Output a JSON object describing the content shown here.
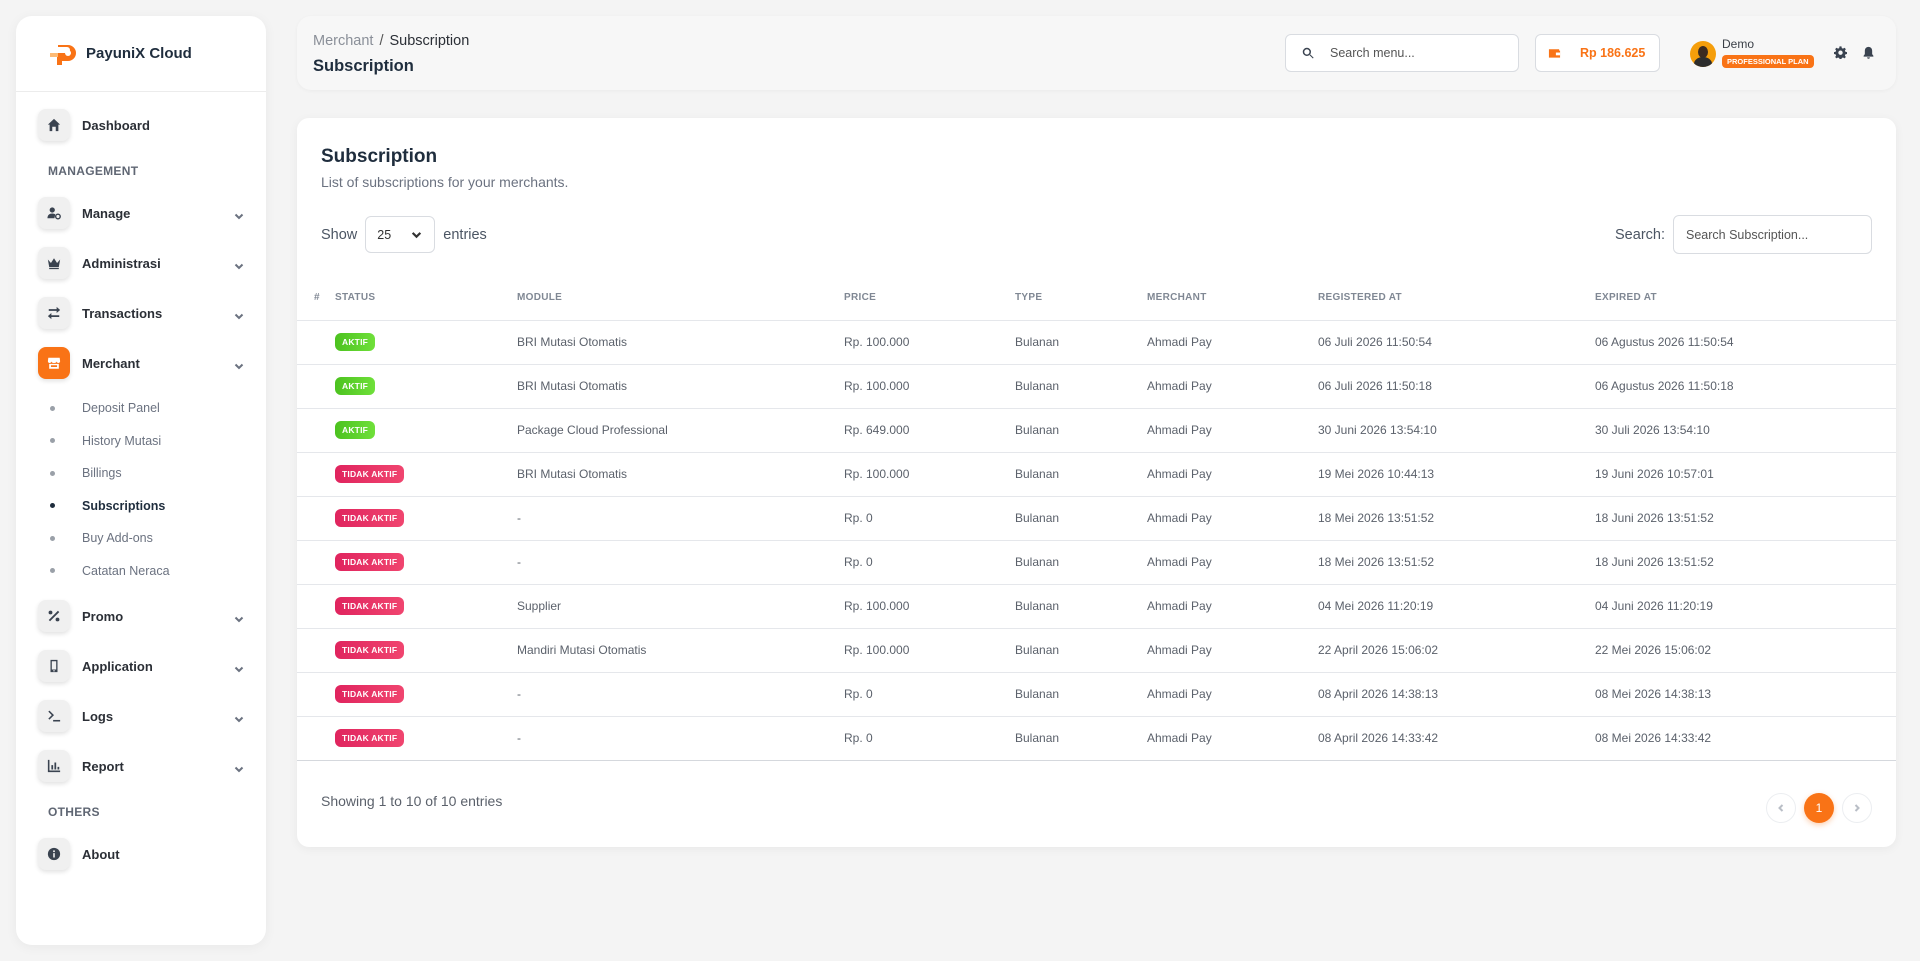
{
  "brand": {
    "name": "PayuniX Cloud"
  },
  "sidebar": {
    "dashboard": "Dashboard",
    "section_management": "MANAGEMENT",
    "items": [
      {
        "label": "Manage",
        "icon": "user-cog-icon"
      },
      {
        "label": "Administrasi",
        "icon": "crown-icon"
      },
      {
        "label": "Transactions",
        "icon": "arrows-exchange-icon"
      },
      {
        "label": "Merchant",
        "icon": "store-icon"
      }
    ],
    "merchant_sub": [
      {
        "label": "Deposit Panel"
      },
      {
        "label": "History Mutasi"
      },
      {
        "label": "Billings"
      },
      {
        "label": "Subscriptions",
        "active": true
      },
      {
        "label": "Buy Add-ons"
      },
      {
        "label": "Catatan Neraca"
      }
    ],
    "items2": [
      {
        "label": "Promo",
        "icon": "percent-icon"
      },
      {
        "label": "Application",
        "icon": "mobile-icon"
      },
      {
        "label": "Logs",
        "icon": "terminal-icon"
      },
      {
        "label": "Report",
        "icon": "chart-icon"
      }
    ],
    "section_others": "OTHERS",
    "about": "About"
  },
  "header": {
    "breadcrumb_parent": "Merchant",
    "breadcrumb_sep": "/",
    "breadcrumb_current": "Subscription",
    "title": "Subscription",
    "search_placeholder": "Search menu...",
    "balance": "Rp 186.625",
    "user_name": "Demo",
    "plan": "PROFESSIONAL PLAN"
  },
  "card": {
    "title": "Subscription",
    "subtitle": "List of subscriptions for your merchants.",
    "show_label": "Show",
    "page_length": "25",
    "entries_label": "entries",
    "search_label": "Search:",
    "search_placeholder": "Search Subscription...",
    "columns": [
      "#",
      "STATUS",
      "MODULE",
      "PRICE",
      "TYPE",
      "MERCHANT",
      "REGISTERED AT",
      "EXPIRED AT"
    ],
    "rows": [
      {
        "status": "AKTIF",
        "active": true,
        "module": "BRI Mutasi Otomatis",
        "price": "Rp. 100.000",
        "type": "Bulanan",
        "merchant": "Ahmadi Pay",
        "registered": "06 Juli 2026 11:50:54",
        "expired": "06 Agustus 2026 11:50:54"
      },
      {
        "status": "AKTIF",
        "active": true,
        "module": "BRI Mutasi Otomatis",
        "price": "Rp. 100.000",
        "type": "Bulanan",
        "merchant": "Ahmadi Pay",
        "registered": "06 Juli 2026 11:50:18",
        "expired": "06 Agustus 2026 11:50:18"
      },
      {
        "status": "AKTIF",
        "active": true,
        "module": "Package Cloud Professional",
        "price": "Rp. 649.000",
        "type": "Bulanan",
        "merchant": "Ahmadi Pay",
        "registered": "30 Juni 2026 13:54:10",
        "expired": "30 Juli 2026 13:54:10"
      },
      {
        "status": "TIDAK AKTIF",
        "active": false,
        "module": "BRI Mutasi Otomatis",
        "price": "Rp. 100.000",
        "type": "Bulanan",
        "merchant": "Ahmadi Pay",
        "registered": "19 Mei 2026 10:44:13",
        "expired": "19 Juni 2026 10:57:01"
      },
      {
        "status": "TIDAK AKTIF",
        "active": false,
        "module": "-",
        "price": "Rp. 0",
        "type": "Bulanan",
        "merchant": "Ahmadi Pay",
        "registered": "18 Mei 2026 13:51:52",
        "expired": "18 Juni 2026 13:51:52"
      },
      {
        "status": "TIDAK AKTIF",
        "active": false,
        "module": "-",
        "price": "Rp. 0",
        "type": "Bulanan",
        "merchant": "Ahmadi Pay",
        "registered": "18 Mei 2026 13:51:52",
        "expired": "18 Juni 2026 13:51:52"
      },
      {
        "status": "TIDAK AKTIF",
        "active": false,
        "module": "Supplier",
        "price": "Rp. 100.000",
        "type": "Bulanan",
        "merchant": "Ahmadi Pay",
        "registered": "04 Mei 2026 11:20:19",
        "expired": "04 Juni 2026 11:20:19"
      },
      {
        "status": "TIDAK AKTIF",
        "active": false,
        "module": "Mandiri Mutasi Otomatis",
        "price": "Rp. 100.000",
        "type": "Bulanan",
        "merchant": "Ahmadi Pay",
        "registered": "22 April 2026 15:06:02",
        "expired": "22 Mei 2026 15:06:02"
      },
      {
        "status": "TIDAK AKTIF",
        "active": false,
        "module": "-",
        "price": "Rp. 0",
        "type": "Bulanan",
        "merchant": "Ahmadi Pay",
        "registered": "08 April 2026 14:38:13",
        "expired": "08 Mei 2026 14:38:13"
      },
      {
        "status": "TIDAK AKTIF",
        "active": false,
        "module": "-",
        "price": "Rp. 0",
        "type": "Bulanan",
        "merchant": "Ahmadi Pay",
        "registered": "08 April 2026 14:33:42",
        "expired": "08 Mei 2026 14:33:42"
      }
    ],
    "info": "Showing 1 to 10 of 10 entries",
    "current_page": "1"
  },
  "colors": {
    "accent": "#f97316",
    "active_badge": "#52c41a",
    "inactive_badge": "#e8305f"
  }
}
